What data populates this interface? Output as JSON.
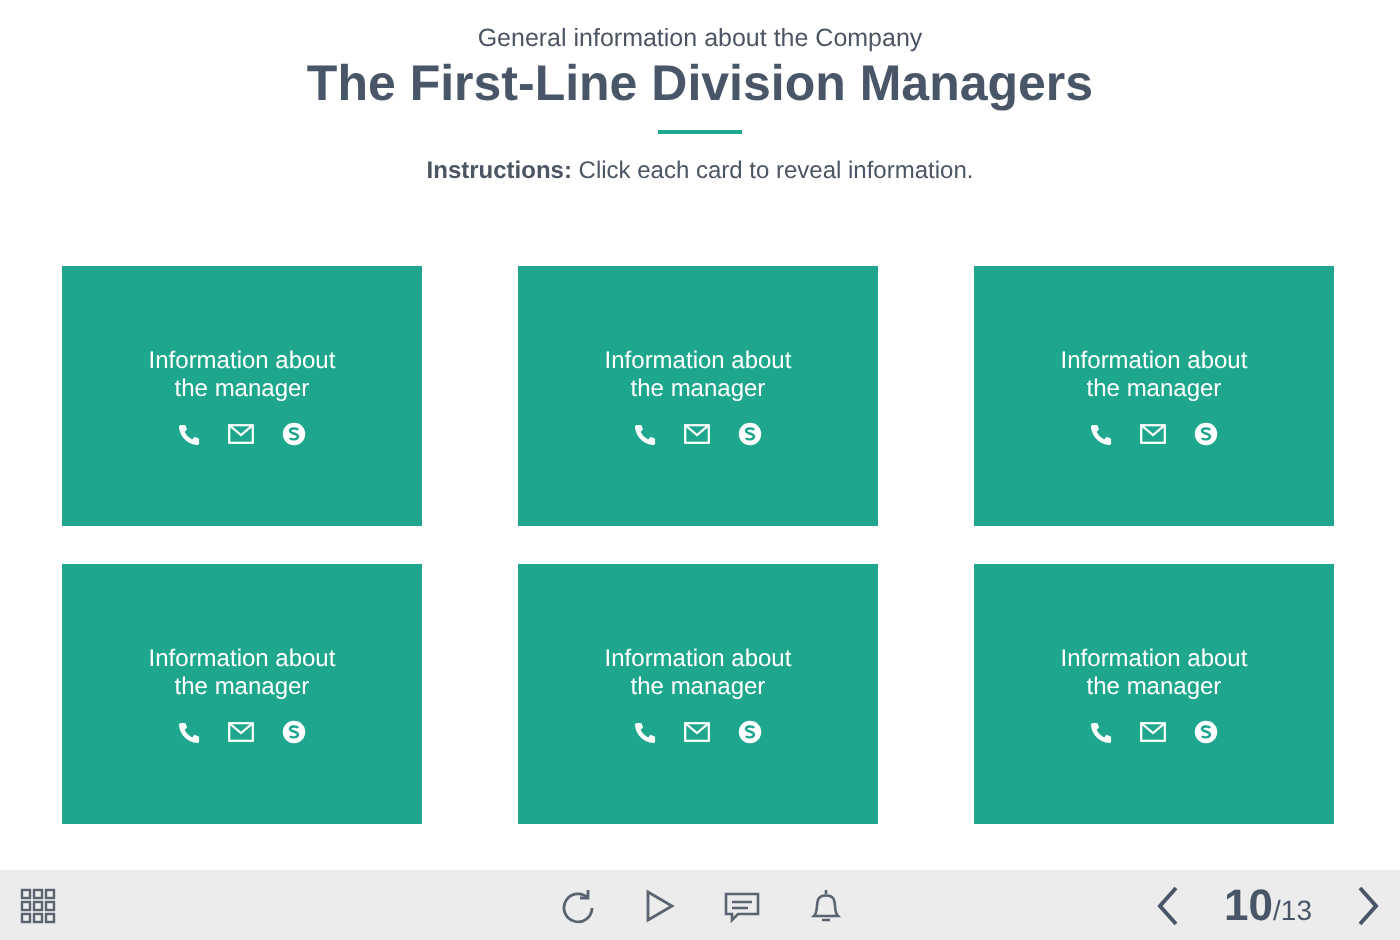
{
  "header": {
    "subtitle": "General information about the Company",
    "title": "The First-Line Division Managers",
    "instructions": "**Instructions:** Click each card to reveal information."
  },
  "cards": [
    {
      "text": "Information about the manager"
    },
    {
      "text": "Information about the manager"
    },
    {
      "text": "Information about the manager"
    },
    {
      "text": "Information about the manager"
    },
    {
      "text": "Information about the manager"
    },
    {
      "text": "Information about the manager"
    }
  ],
  "player": {
    "current": "10",
    "total": "/13"
  }
}
